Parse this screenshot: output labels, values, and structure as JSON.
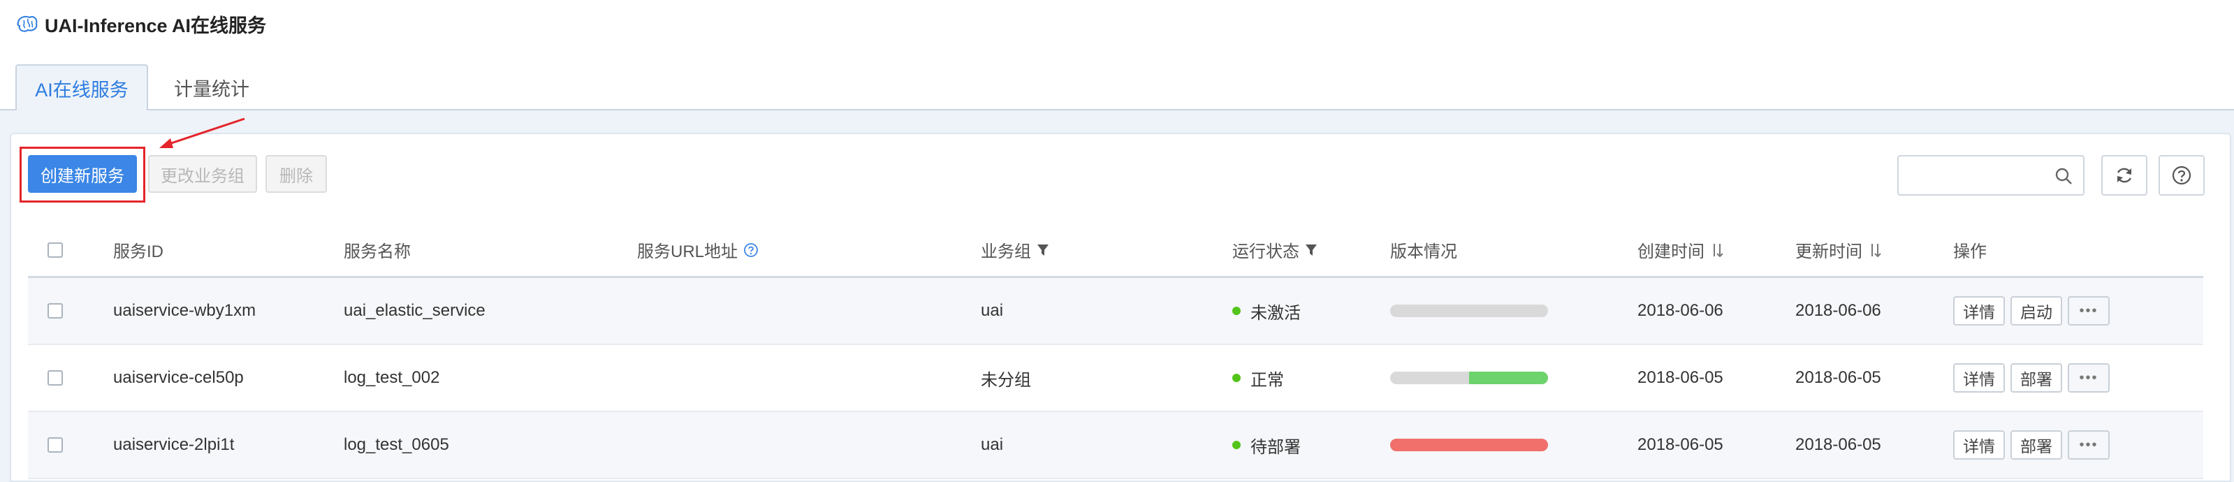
{
  "app": {
    "title": "UAI-Inference AI在线服务"
  },
  "tabs": [
    {
      "label": "AI在线服务",
      "active": true
    },
    {
      "label": "计量统计",
      "active": false
    }
  ],
  "toolbar": {
    "create_label": "创建新服务",
    "change_group_label": "更改业务组",
    "delete_label": "删除",
    "search_value": ""
  },
  "table": {
    "headers": {
      "id": "服务ID",
      "name": "服务名称",
      "url": "服务URL地址",
      "group": "业务组",
      "status": "运行状态",
      "version": "版本情况",
      "created": "创建时间",
      "updated": "更新时间",
      "ops": "操作"
    },
    "rows": [
      {
        "id": "uaiservice-wby1xm",
        "name": "uai_elastic_service",
        "url": "",
        "group": "uai",
        "status": "未激活",
        "version": {
          "gray": 1.0,
          "green": 0.0,
          "red": 0.0
        },
        "created": "2018-06-06",
        "updated": "2018-06-06",
        "ops": [
          "详情",
          "启动"
        ]
      },
      {
        "id": "uaiservice-cel50p",
        "name": "log_test_002",
        "url": "",
        "group": "未分组",
        "status": "正常",
        "version": {
          "gray": 0.5,
          "green": 0.5,
          "red": 0.0
        },
        "created": "2018-06-05",
        "updated": "2018-06-05",
        "ops": [
          "详情",
          "部署"
        ]
      },
      {
        "id": "uaiservice-2lpi1t",
        "name": "log_test_0605",
        "url": "",
        "group": "uai",
        "status": "待部署",
        "version": {
          "gray": 0.0,
          "green": 0.0,
          "red": 1.0
        },
        "created": "2018-06-05",
        "updated": "2018-06-05",
        "ops": [
          "详情",
          "部署"
        ]
      }
    ],
    "more_label": "•••"
  },
  "colors": {
    "primary": "#3b86e6",
    "status_dot": "#52c41a",
    "progress_gray": "#d9d9d9",
    "progress_green": "#6dd36d",
    "progress_red": "#f2706b",
    "highlight_red": "#e4252b"
  }
}
